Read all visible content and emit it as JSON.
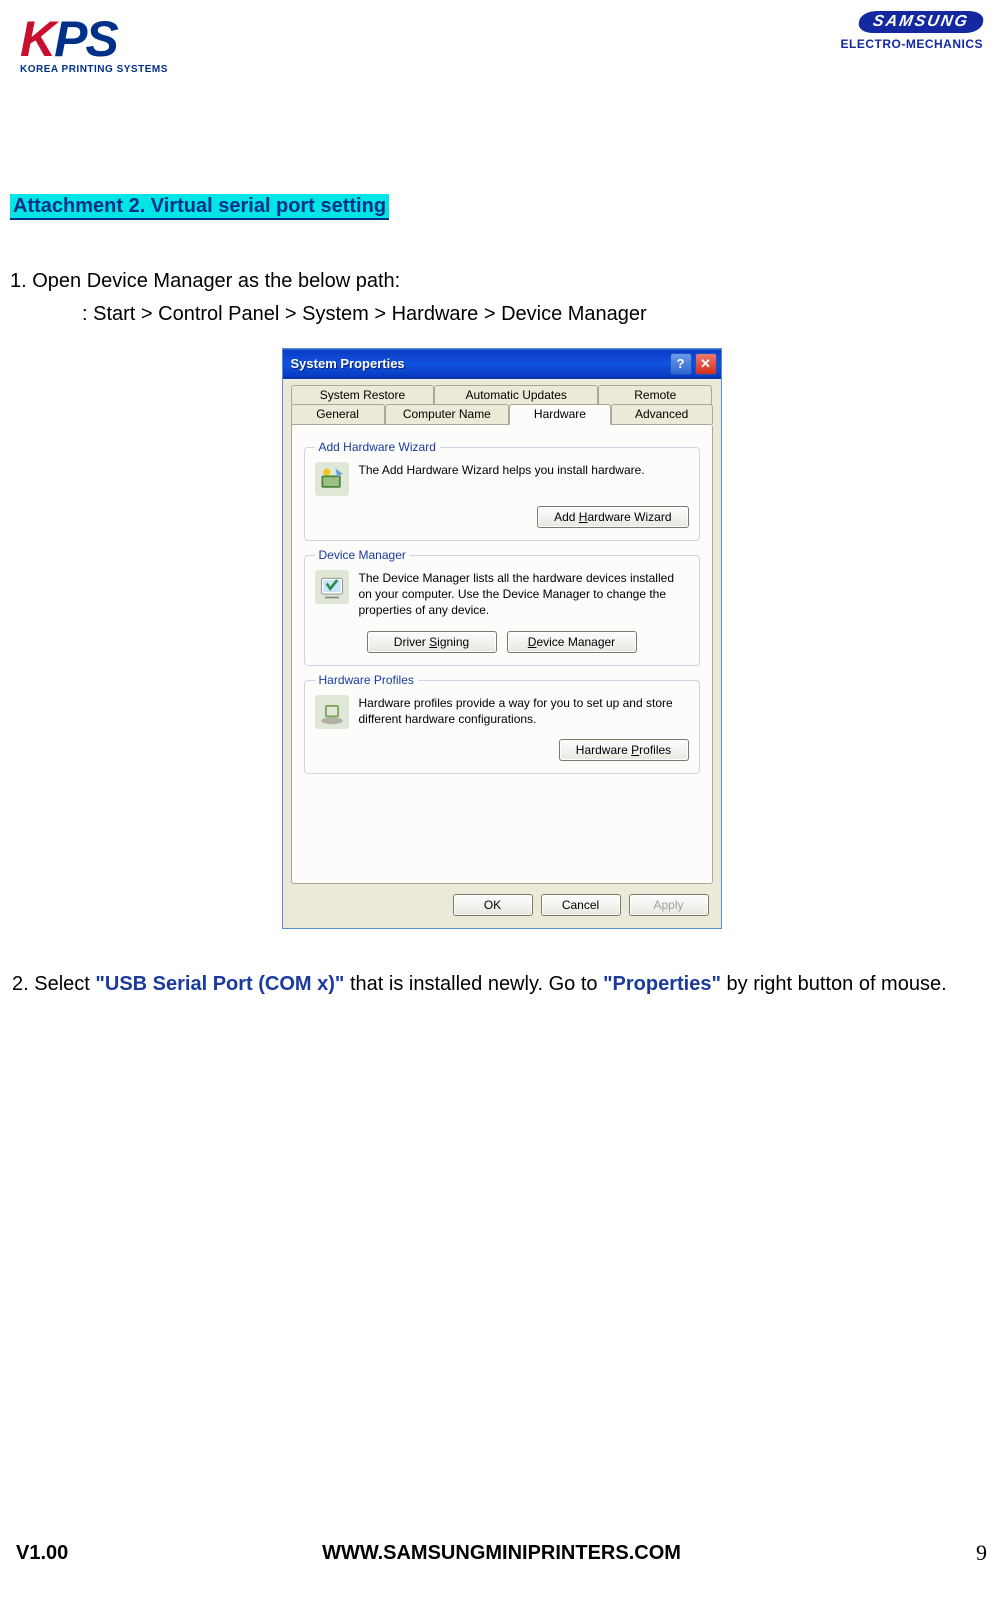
{
  "header": {
    "left_logo_letters": [
      "K",
      "P",
      "S"
    ],
    "left_logo_sub": "KOREA PRINTING SYSTEMS",
    "right_logo_word": "SAMSUNG",
    "right_logo_sub": "ELECTRO-MECHANICS"
  },
  "attachment_title": "Attachment 2. Virtual serial port setting",
  "step1_text": "1. Open Device Manager as the below path:",
  "step1_path": ": Start > Control Panel > System > Hardware > Device Manager",
  "dialog": {
    "title": "System Properties",
    "tabs_row1": [
      "System Restore",
      "Automatic Updates",
      "Remote"
    ],
    "tabs_row2": [
      "General",
      "Computer Name",
      "Hardware",
      "Advanced"
    ],
    "active_tab": "Hardware",
    "group1": {
      "legend": "Add Hardware Wizard",
      "text": "The Add Hardware Wizard helps you install hardware.",
      "button": "Add Hardware Wizard",
      "button_hotkey": "H"
    },
    "group2": {
      "legend": "Device Manager",
      "text": "The Device Manager lists all the hardware devices installed on your computer. Use the Device Manager to change the properties of any device.",
      "button_left": "Driver Signing",
      "button_left_hotkey": "S",
      "button_right": "Device Manager",
      "button_right_hotkey": "D"
    },
    "group3": {
      "legend": "Hardware Profiles",
      "text": "Hardware profiles provide a way for you to set up and store different hardware configurations.",
      "button": "Hardware Profiles",
      "button_hotkey": "P"
    },
    "buttons": {
      "ok": "OK",
      "cancel": "Cancel",
      "apply": "Apply"
    }
  },
  "step2": {
    "prefix": "2. Select ",
    "blue1": "\"USB Serial Port (COM x)\"",
    "mid": " that is installed newly. Go to ",
    "blue2": "\"Properties\"",
    "suffix": " by right button of mouse."
  },
  "footer": {
    "version": "V1.00",
    "url": "WWW.SAMSUNGMINIPRINTERS.COM",
    "page": "9"
  }
}
